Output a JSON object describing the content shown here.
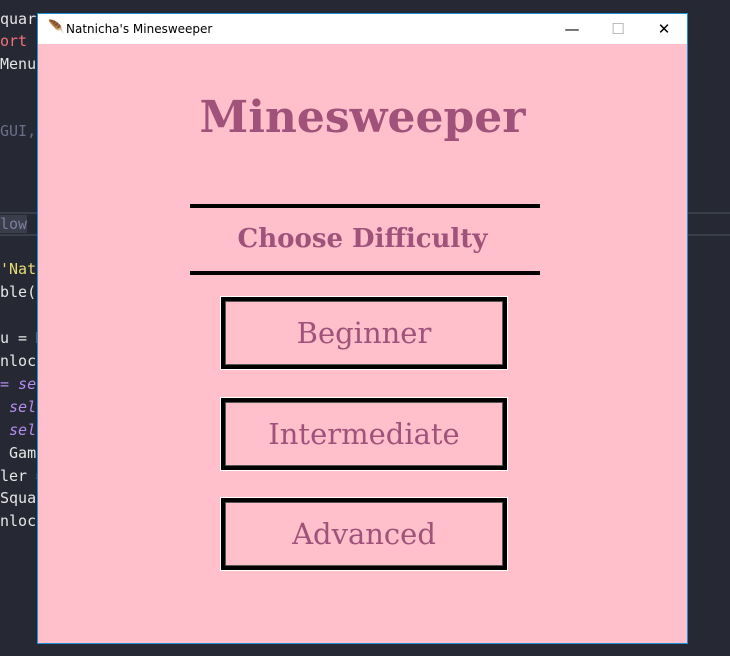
{
  "background_code": [
    "quare",
    "ort E",
    "Menu",
    "GUI,",
    "low",
    "'Natr",
    "ble(F",
    "u = M",
    "nloc",
    "= sel",
    " self",
    " self",
    " Game",
    "ler =",
    "Squar",
    "nloc"
  ],
  "window": {
    "title": "Natnicha's Minesweeper",
    "icon": "feather-icon",
    "minimize": "—",
    "maximize": "☐",
    "close": "✕"
  },
  "main": {
    "title": "Minesweeper",
    "subtitle": "Choose Difficulty",
    "buttons": [
      {
        "label": "Beginner"
      },
      {
        "label": "Intermediate"
      },
      {
        "label": "Advanced"
      }
    ]
  },
  "colors": {
    "background": "#ffc0cb",
    "text": "#a0527a"
  }
}
